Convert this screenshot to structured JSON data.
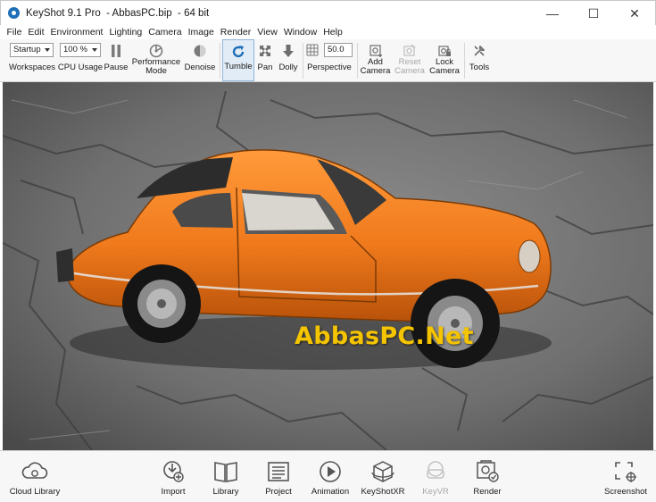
{
  "window": {
    "title": "KeyShot 9.1 Pro  - AbbasPC.bip  - 64 bit",
    "minimize": "—",
    "maximize": "☐",
    "close": "✕"
  },
  "menu": [
    "File",
    "Edit",
    "Environment",
    "Lighting",
    "Camera",
    "Image",
    "Render",
    "View",
    "Window",
    "Help"
  ],
  "ribbon": {
    "workspaces": {
      "value": "Startup",
      "label": "Workspaces"
    },
    "cpu_usage": {
      "value": "100 %",
      "label": "CPU Usage"
    },
    "pause": "Pause",
    "performance_mode": "Performance Mode",
    "denoise": "Denoise",
    "tumble": "Tumble",
    "pan": "Pan",
    "dolly": "Dolly",
    "perspective": {
      "value": "50.0",
      "label": "Perspective"
    },
    "add_camera": "Add Camera",
    "reset_camera": "Reset Camera",
    "lock_camera": "Lock Camera",
    "tools": "Tools"
  },
  "viewport": {
    "watermark": "AbbasPC.Net"
  },
  "bottom": {
    "cloud_library": "Cloud Library",
    "import": "Import",
    "library": "Library",
    "project": "Project",
    "animation": "Animation",
    "keyshotxr": "KeyShotXR",
    "keyvr": "KeyVR",
    "render": "Render",
    "screenshot": "Screenshot"
  },
  "colors": {
    "accent": "#1f6fb8",
    "car_orange": "#f07a1c",
    "watermark": "#f5c400",
    "active_tool_bg": "#e2ecf6"
  }
}
